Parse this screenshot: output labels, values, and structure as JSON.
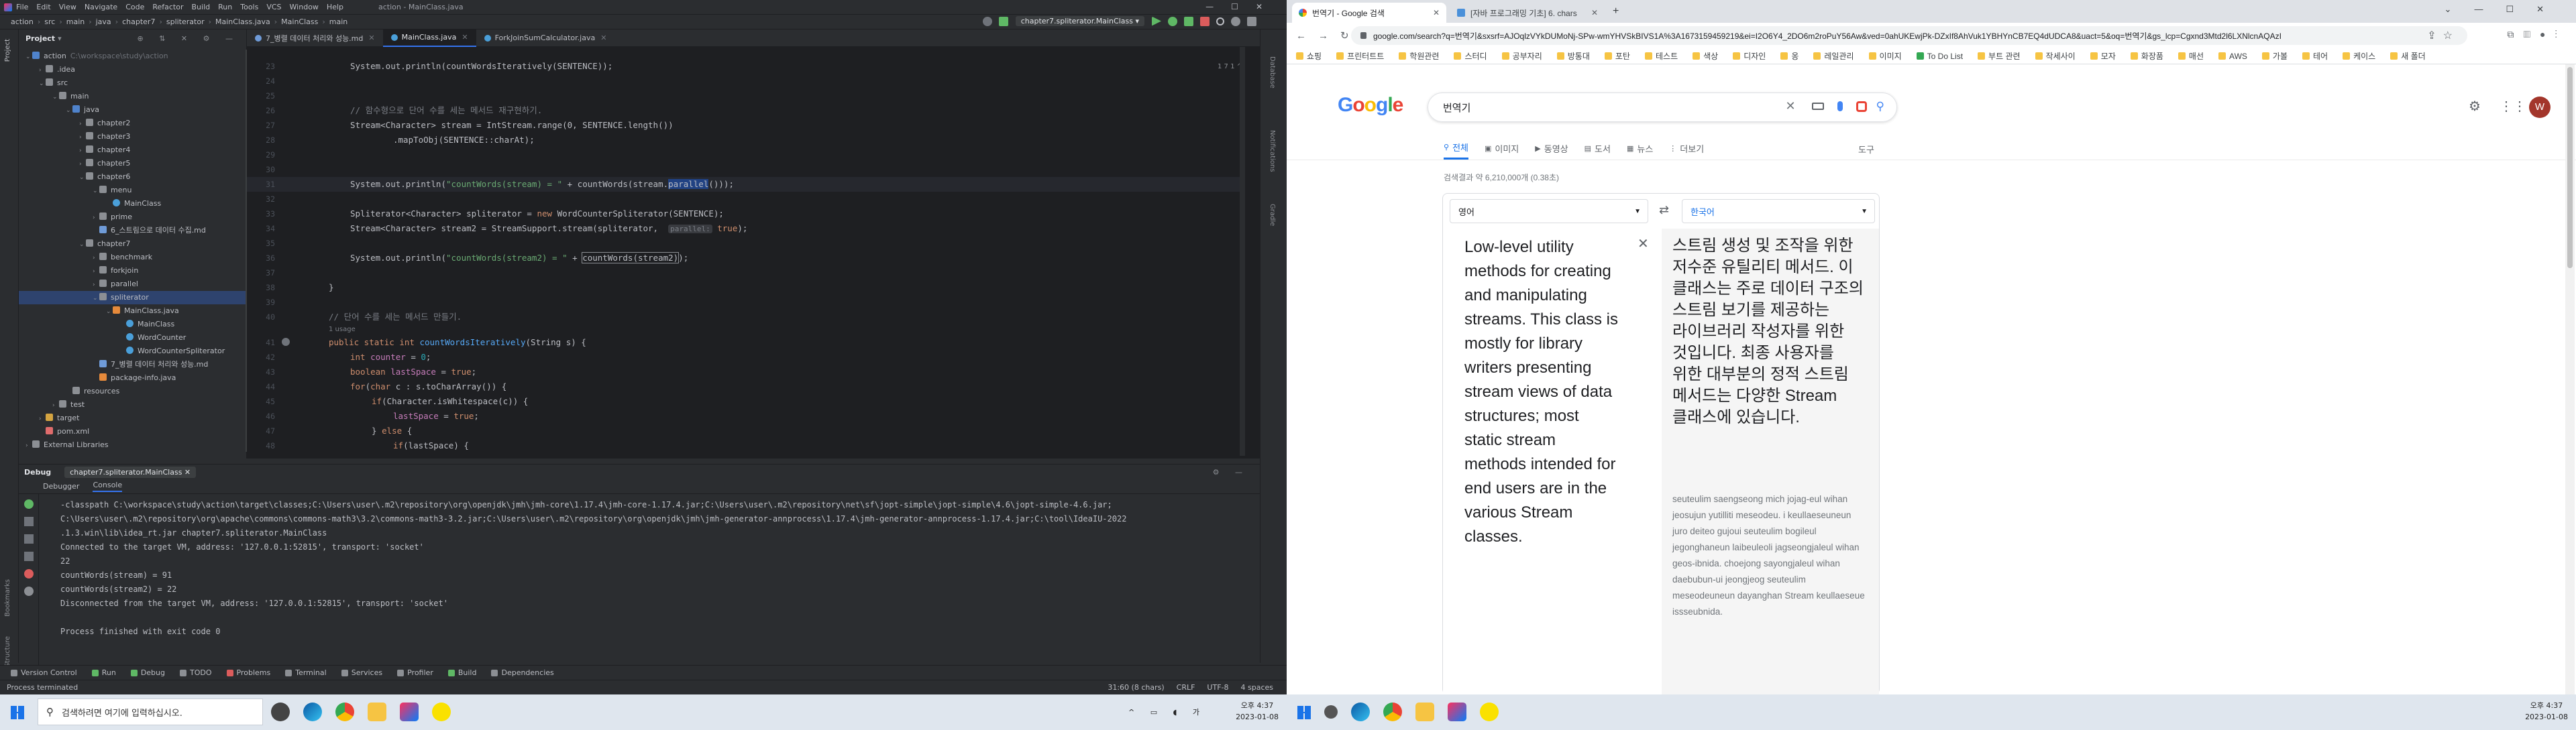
{
  "ide": {
    "menu": [
      "File",
      "Edit",
      "View",
      "Navigate",
      "Code",
      "Refactor",
      "Build",
      "Run",
      "Tools",
      "VCS",
      "Window",
      "Help"
    ],
    "window_title": "action - MainClass.java",
    "breadcrumb": [
      "action",
      "src",
      "main",
      "java",
      "chapter7",
      "spliterator",
      "MainClass.java",
      "MainClass",
      "main"
    ],
    "run_config": "chapter7.spliterator.MainClass",
    "project_label": "Project",
    "side_tabs": [
      "Project",
      "Bookmarks",
      "Structure"
    ],
    "right_tabs": [
      "Database",
      "Notifications",
      "Gradle"
    ],
    "editor_tabs": [
      {
        "label": "7_병렬 데이터 처리와 성능.md",
        "active": false
      },
      {
        "label": "MainClass.java",
        "active": true
      },
      {
        "label": "ForkJoinSumCalculator.java",
        "active": false
      }
    ],
    "tree": [
      {
        "label": "action",
        "path": "C:\\workspace\\study\\action",
        "indent": 0,
        "open": true,
        "kind": "module"
      },
      {
        "label": ".idea",
        "indent": 1,
        "open": false,
        "kind": "folder"
      },
      {
        "label": "src",
        "indent": 1,
        "open": true,
        "kind": "folder"
      },
      {
        "label": "main",
        "indent": 2,
        "open": true,
        "kind": "folder"
      },
      {
        "label": "java",
        "indent": 3,
        "open": true,
        "kind": "src"
      },
      {
        "label": "chapter2",
        "indent": 4,
        "open": false,
        "kind": "pkg"
      },
      {
        "label": "chapter3",
        "indent": 4,
        "open": false,
        "kind": "pkg"
      },
      {
        "label": "chapter4",
        "indent": 4,
        "open": false,
        "kind": "pkg"
      },
      {
        "label": "chapter5",
        "indent": 4,
        "open": false,
        "kind": "pkg"
      },
      {
        "label": "chapter6",
        "indent": 4,
        "open": true,
        "kind": "pkg"
      },
      {
        "label": "menu",
        "indent": 5,
        "open": true,
        "kind": "pkg"
      },
      {
        "label": "MainClass",
        "indent": 6,
        "kind": "class"
      },
      {
        "label": "prime",
        "indent": 5,
        "open": false,
        "kind": "pkg"
      },
      {
        "label": "6_스트림으로 데이터 수집.md",
        "indent": 5,
        "kind": "md"
      },
      {
        "label": "chapter7",
        "indent": 4,
        "open": true,
        "kind": "pkg"
      },
      {
        "label": "benchmark",
        "indent": 5,
        "open": false,
        "kind": "pkg"
      },
      {
        "label": "forkjoin",
        "indent": 5,
        "open": false,
        "kind": "pkg"
      },
      {
        "label": "parallel",
        "indent": 5,
        "open": false,
        "kind": "pkg"
      },
      {
        "label": "spliterator",
        "indent": 5,
        "open": true,
        "kind": "pkg",
        "selected": true
      },
      {
        "label": "MainClass.java",
        "indent": 6,
        "open": true,
        "kind": "java"
      },
      {
        "label": "MainClass",
        "indent": 7,
        "kind": "class"
      },
      {
        "label": "WordCounter",
        "indent": 7,
        "kind": "class"
      },
      {
        "label": "WordCounterSpliterator",
        "indent": 7,
        "kind": "class"
      },
      {
        "label": "7_병렬 데이터 처리와 성능.md",
        "indent": 5,
        "kind": "md"
      },
      {
        "label": "package-info.java",
        "indent": 5,
        "kind": "java"
      },
      {
        "label": "resources",
        "indent": 3,
        "kind": "folder"
      },
      {
        "label": "test",
        "indent": 2,
        "open": false,
        "kind": "folder"
      },
      {
        "label": "target",
        "indent": 1,
        "open": false,
        "kind": "excluded"
      },
      {
        "label": "pom.xml",
        "indent": 1,
        "kind": "xml"
      },
      {
        "label": "External Libraries",
        "indent": 0,
        "open": false,
        "kind": "lib"
      }
    ],
    "code_lines": [
      {
        "n": "23",
        "segs": [
          [
            "",
            "System.out.println(countWordsIteratively(SENTENCE));"
          ]
        ],
        "ind": 2
      },
      {
        "n": "24",
        "segs": [],
        "ind": 0
      },
      {
        "n": "25",
        "segs": [],
        "ind": 0
      },
      {
        "n": "26",
        "segs": [
          [
            "cm",
            "// 함수형으로 단어 수를 세는 메서드 재구현하기."
          ]
        ],
        "ind": 2
      },
      {
        "n": "27",
        "segs": [
          [
            "",
            "Stream<Character> stream = IntStream.range(0, SENTENCE.length())"
          ]
        ],
        "ind": 2
      },
      {
        "n": "28",
        "segs": [
          [
            "",
            ".mapToObj(SENTENCE::charAt);"
          ]
        ],
        "ind": 4
      },
      {
        "n": "29",
        "segs": [],
        "ind": 0
      },
      {
        "n": "30",
        "segs": [],
        "ind": 0
      },
      {
        "n": "31",
        "segs": [
          [
            "",
            "System.out.println("
          ],
          [
            "str",
            "\"countWords(stream) = \""
          ],
          [
            "",
            " + countWords(stream."
          ],
          [
            "sel",
            "parallel"
          ],
          [
            "",
            "()));"
          ]
        ],
        "ind": 2,
        "current": true
      },
      {
        "n": "32",
        "segs": [],
        "ind": 0
      },
      {
        "n": "33",
        "segs": [
          [
            "",
            "Spliterator<Character> spliterator = "
          ],
          [
            "kw",
            "new "
          ],
          [
            "",
            "WordCounterSpliterator(SENTENCE);"
          ]
        ],
        "ind": 2
      },
      {
        "n": "34",
        "segs": [
          [
            "",
            "Stream<Character> stream2 = StreamSupport.stream(spliterator,  "
          ],
          [
            "hint",
            "parallel:"
          ],
          [
            "kw",
            " true"
          ],
          [
            "",
            ");"
          ]
        ],
        "ind": 2
      },
      {
        "n": "35",
        "segs": [],
        "ind": 0
      },
      {
        "n": "36",
        "segs": [
          [
            "",
            "System.out.println("
          ],
          [
            "str",
            "\"countWords(stream2) = \""
          ],
          [
            "",
            " + "
          ],
          [
            "box",
            "countWords(stream2)"
          ],
          [
            "",
            ");"
          ]
        ],
        "ind": 2
      },
      {
        "n": "37",
        "segs": [],
        "ind": 0
      },
      {
        "n": "38",
        "segs": [
          [
            "",
            "}"
          ]
        ],
        "ind": 1
      },
      {
        "n": "39",
        "segs": [],
        "ind": 0
      },
      {
        "n": "40",
        "segs": [
          [
            "cm",
            "// 단어 수를 세는 메서드 만들기."
          ]
        ],
        "ind": 1
      },
      {
        "n": "",
        "segs": [
          [
            "cm",
            "1 usage"
          ]
        ],
        "ind": 1,
        "small": true
      },
      {
        "n": "41",
        "segs": [
          [
            "kw",
            "public static int "
          ],
          [
            "fn",
            "countWordsIteratively"
          ],
          [
            "",
            "(String s) {"
          ]
        ],
        "ind": 1
      },
      {
        "n": "42",
        "segs": [
          [
            "kw",
            "int "
          ],
          [
            "fld",
            "counter"
          ],
          [
            "",
            " = "
          ],
          [
            "num",
            "0"
          ],
          [
            "",
            ";"
          ]
        ],
        "ind": 2
      },
      {
        "n": "43",
        "segs": [
          [
            "kw",
            "boolean "
          ],
          [
            "fld",
            "lastSpace"
          ],
          [
            "",
            " = "
          ],
          [
            "kw",
            "true"
          ],
          [
            "",
            ";"
          ]
        ],
        "ind": 2
      },
      {
        "n": "44",
        "segs": [
          [
            "kw",
            "for"
          ],
          [
            "",
            "("
          ],
          [
            "kw",
            "char "
          ],
          [
            "",
            "c : s.toCharArray()) {"
          ]
        ],
        "ind": 2
      },
      {
        "n": "45",
        "segs": [
          [
            "kw",
            "if"
          ],
          [
            "",
            "(Character.isWhitespace(c)) {"
          ]
        ],
        "ind": 3
      },
      {
        "n": "46",
        "segs": [
          [
            "fld",
            "lastSpace"
          ],
          [
            "",
            " = "
          ],
          [
            "kw",
            "true"
          ],
          [
            "",
            ";"
          ]
        ],
        "ind": 4
      },
      {
        "n": "47",
        "segs": [
          [
            "",
            "} "
          ],
          [
            "kw",
            "else "
          ],
          [
            "",
            "{"
          ]
        ],
        "ind": 3
      },
      {
        "n": "48",
        "segs": [
          [
            "kw",
            "if"
          ],
          [
            "",
            "(lastSpace) {"
          ]
        ],
        "ind": 4
      }
    ],
    "debug_title": "Debug",
    "debug_tab": "chapter7.spliterator.MainClass",
    "debug_subtabs": [
      "Debugger",
      "Console"
    ],
    "console": [
      "-classpath C:\\workspace\\study\\action\\target\\classes;C:\\Users\\user\\.m2\\repository\\org\\openjdk\\jmh\\jmh-core\\1.17.4\\jmh-core-1.17.4.jar;C:\\Users\\user\\.m2\\repository\\net\\sf\\jopt-simple\\jopt-simple\\4.6\\jopt-simple-4.6.jar;",
      "C:\\Users\\user\\.m2\\repository\\org\\apache\\commons\\commons-math3\\3.2\\commons-math3-3.2.jar;C:\\Users\\user\\.m2\\repository\\org\\openjdk\\jmh\\jmh-generator-annprocess\\1.17.4\\jmh-generator-annprocess-1.17.4.jar;C:\\tool\\IdeaIU-2022",
      ".1.3.win\\lib\\idea_rt.jar chapter7.spliterator.MainClass",
      "Connected to the target VM, address: '127.0.0.1:52815', transport: 'socket'",
      "22",
      "countWords(stream) = 91",
      "countWords(stream2) = 22",
      "Disconnected from the target VM, address: '127.0.0.1:52815', transport: 'socket'",
      "",
      "Process finished with exit code 0"
    ],
    "bottom_tools": [
      "Version Control",
      "Run",
      "Debug",
      "TODO",
      "Problems",
      "Terminal",
      "Services",
      "Profiler",
      "Build",
      "Dependencies"
    ],
    "status_left": "Process terminated",
    "status_right": [
      "31:60 (8 chars)",
      "CRLF",
      "UTF-8",
      "4 spaces"
    ],
    "inspections": "1 7 1 ^"
  },
  "browser": {
    "tabs": [
      {
        "label": "번역기 - Google 검색",
        "active": true
      },
      {
        "label": "[자바 프로그래밍 기초] 6. chars",
        "active": false
      }
    ],
    "url": "google.com/search?q=번역기&sxsrf=AJOqlzVYkDUMoNj-SPw-wmYHVSkBIVS1A%3A1673159459219&ei=I2O6Y4_2DO6m2roPuY56Aw&ved=0ahUKEwjPk-DZxIf8AhVuk1YBHYnCB7EQ4dUDCA8&uact=5&oq=번역기&gs_lcp=Cgxnd3Mtd2l6LXNlcnAQAzI",
    "bookmarks": [
      "쇼핑",
      "프린터트트",
      "학원관련",
      "스터디",
      "공부자리",
      "방통대",
      "포탄",
      "테스트",
      "색상",
      "디자인",
      "옹",
      "레일관리",
      "이미지",
      "To Do List",
      "부트 관련",
      "작세사이",
      "모자",
      "화장품",
      "매선",
      "AWS",
      "가볼",
      "테어",
      "케이스",
      "새 폴더"
    ],
    "search_query": "번역기",
    "gtabs": [
      "전체",
      "이미지",
      "동영상",
      "도서",
      "뉴스",
      "더보기"
    ],
    "gtools": "도구",
    "result_stats": "검색결과 약 6,210,000개 (0.38초)",
    "avatar": "W",
    "translate": {
      "source_lang": "영어",
      "target_lang": "한국어",
      "source_text": "Low-level utility methods for creating and manipulating streams. This class is mostly for library writers presenting stream views of data structures; most static stream methods intended for end users are in the various Stream classes.",
      "target_text": "스트림 생성 및 조작을 위한 저수준 유틸리티 메서드. 이 클래스는 주로 데이터 구조의 스트림 보기를 제공하는 라이브러리 작성자를 위한 것입니다. 최종 사용자를 위한 대부분의 정적 스트림 메서드는 다양한 Stream 클래스에 있습니다.",
      "romanization": "seuteulim saengseong mich jojag-eul wihan jeosujun yutilliti meseodeu. i keullaeseuneun juro deiteo gujoui seuteulim bogileul jegonghaneun laibeuleoli jagseongjaleul wihan geos-ibnida. choejong sayongjaleul wihan daebubun-ui jeongjeog seuteulim meseodeuneun dayanghan Stream keullaeseue issseubnida."
    }
  },
  "taskbar": {
    "search_placeholder": "검색하려면 여기에 입력하십시오.",
    "time_left": "오후 4:37",
    "date_left": "2023-01-08",
    "time_right": "오후 4:37",
    "date_right": "2023-01-08"
  },
  "colors": {
    "ide_bg": "#1e1f22",
    "accent": "#3574f0",
    "google_blue": "#1a73e8"
  }
}
